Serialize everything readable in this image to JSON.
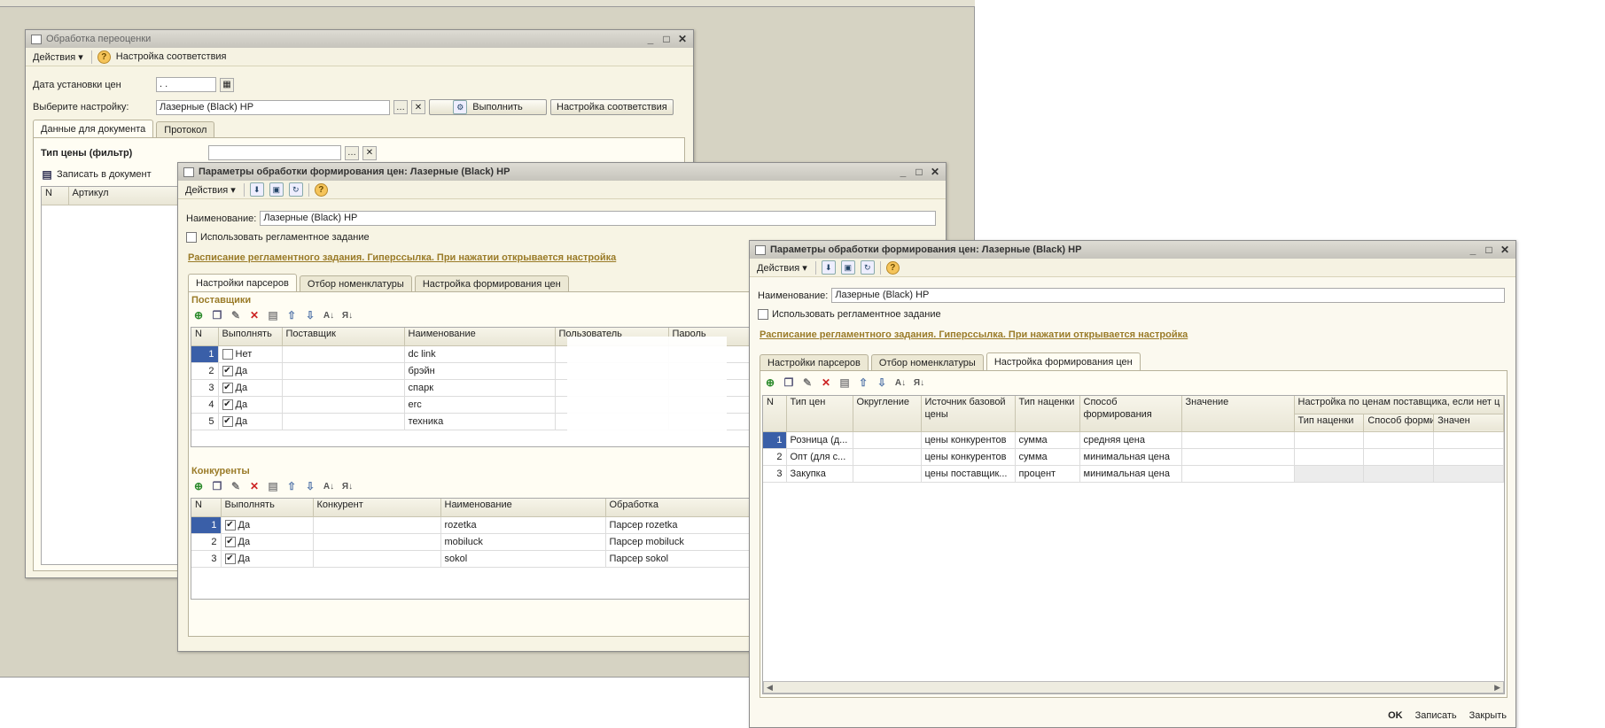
{
  "w1": {
    "title": "Обработка переоценки",
    "actions": "Действия",
    "match_settings_link": "Настройка соответствия",
    "date_label": "Дата установки цен",
    "date_value": ".  .",
    "setting_label": "Выберите настройку:",
    "setting_value": "Лазерные (Black) HP",
    "run_button": "Выполнить",
    "match_button": "Настройка соответствия",
    "tabs": [
      "Данные для документа",
      "Протокол"
    ],
    "price_type_label": "Тип цены (фильтр)",
    "write_doc": "Записать в документ",
    "grid_headers": [
      "N",
      "Артикул"
    ]
  },
  "w2": {
    "title": "Параметры обработки формирования цен: Лазерные (Black) HP",
    "actions": "Действия",
    "name_label": "Наименование:",
    "name_value": "Лазерные (Black) HP",
    "use_task": "Использовать регламентное задание",
    "schedule_link": "Расписание регламентного задания. Гиперссылка. При нажатии открывается настройка",
    "tabs": [
      "Настройки парсеров",
      "Отбор номенклатуры",
      "Настройка формирования цен"
    ],
    "suppliers_title": "Поставщики",
    "suppliers_headers": [
      "N",
      "Выполнять",
      "Поставщик",
      "Наименование",
      "Пользователь",
      "Пароль"
    ],
    "suppliers_rows": [
      {
        "n": "1",
        "checked": false,
        "exec": "Нет",
        "supplier": "",
        "name": "dc link"
      },
      {
        "n": "2",
        "checked": true,
        "exec": "Да",
        "supplier": "",
        "name": "брэйн"
      },
      {
        "n": "3",
        "checked": true,
        "exec": "Да",
        "supplier": "",
        "name": "спарк"
      },
      {
        "n": "4",
        "checked": true,
        "exec": "Да",
        "supplier": "",
        "name": "erc"
      },
      {
        "n": "5",
        "checked": true,
        "exec": "Да",
        "supplier": "",
        "name": "техника"
      }
    ],
    "competitors_title": "Конкуренты",
    "competitors_headers": [
      "N",
      "Выполнять",
      "Конкурент",
      "Наименование",
      "Обработка"
    ],
    "competitors_rows": [
      {
        "n": "1",
        "checked": true,
        "exec": "Да",
        "name": "rozetka",
        "proc": "Парсер rozetka"
      },
      {
        "n": "2",
        "checked": true,
        "exec": "Да",
        "name": "mobiluck",
        "proc": "Парсер mobiluck"
      },
      {
        "n": "3",
        "checked": true,
        "exec": "Да",
        "name": "sokol",
        "proc": "Парсер sokol"
      }
    ]
  },
  "w3": {
    "title": "Параметры обработки формирования цен: Лазерные (Black) HP",
    "actions": "Действия",
    "name_label": "Наименование:",
    "name_value": "Лазерные (Black) HP",
    "use_task": "Использовать регламентное задание",
    "schedule_link": "Расписание регламентного задания. Гиперссылка. При нажатии открывается настройка",
    "tabs": [
      "Настройки парсеров",
      "Отбор номенклатуры",
      "Настройка формирования цен"
    ],
    "headers": [
      "N",
      "Тип цен",
      "Округление",
      "Источник базовой цены",
      "Тип наценки",
      "Способ формирования",
      "Значение"
    ],
    "group_header": "Настройка по ценам поставщика, если нет ц",
    "sub_headers": [
      "Тип наценки",
      "Способ формирова...",
      "Значен"
    ],
    "rows": [
      {
        "n": "1",
        "type": "Розница (д...",
        "round": "",
        "source": "цены конкурентов",
        "markup": "сумма",
        "method": "средняя цена",
        "value": ""
      },
      {
        "n": "2",
        "type": "Опт (для с...",
        "round": "",
        "source": "цены конкурентов",
        "markup": "сумма",
        "method": "минимальная цена",
        "value": ""
      },
      {
        "n": "3",
        "type": "Закупка",
        "round": "",
        "source": "цены поставщик...",
        "markup": "процент",
        "method": "минимальная цена",
        "value": ""
      }
    ],
    "footer": {
      "ok": "OK",
      "save": "Записать",
      "close": "Закрыть"
    }
  }
}
